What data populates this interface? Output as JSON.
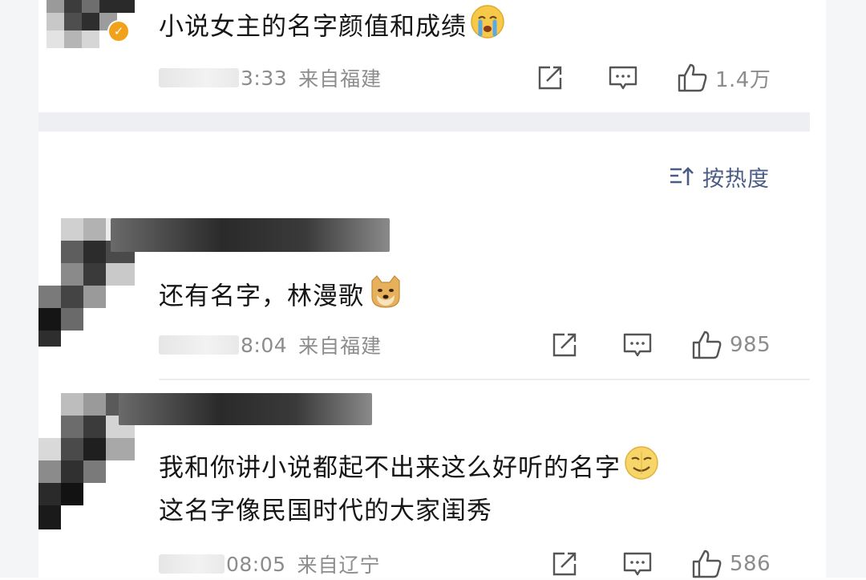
{
  "comments": [
    {
      "text": "小说女主的名字颜值和成绩",
      "time": "3:33",
      "location": "来自福建",
      "likes": "1.4万",
      "verified": true,
      "emoji_icon": "crying-face-emoji"
    },
    {
      "text": "还有名字，林漫歌",
      "time": "8:04",
      "location": "来自福建",
      "likes": "985",
      "emoji_icon": "doge-emoji"
    },
    {
      "text_line1": "我和你讲小说都起不出来这么好听的名字",
      "text_line2": "这名字像民国时代的大家闺秀",
      "time": "08:05",
      "location": "来自辽宁",
      "likes": "586",
      "emoji_icon": "smirk-face-emoji"
    }
  ],
  "sort": {
    "label": "按热度",
    "icon": "sort-icon"
  },
  "icons": {
    "share": "share-icon",
    "comment": "comment-icon",
    "like": "thumbs-up-icon",
    "verified": "verified-badge-icon"
  },
  "colors": {
    "sort_accent": "#4a5c84",
    "meta_gray": "#8c8c8c",
    "verified_badge": "#f2a11b",
    "section_divider": "#eeeff2"
  }
}
